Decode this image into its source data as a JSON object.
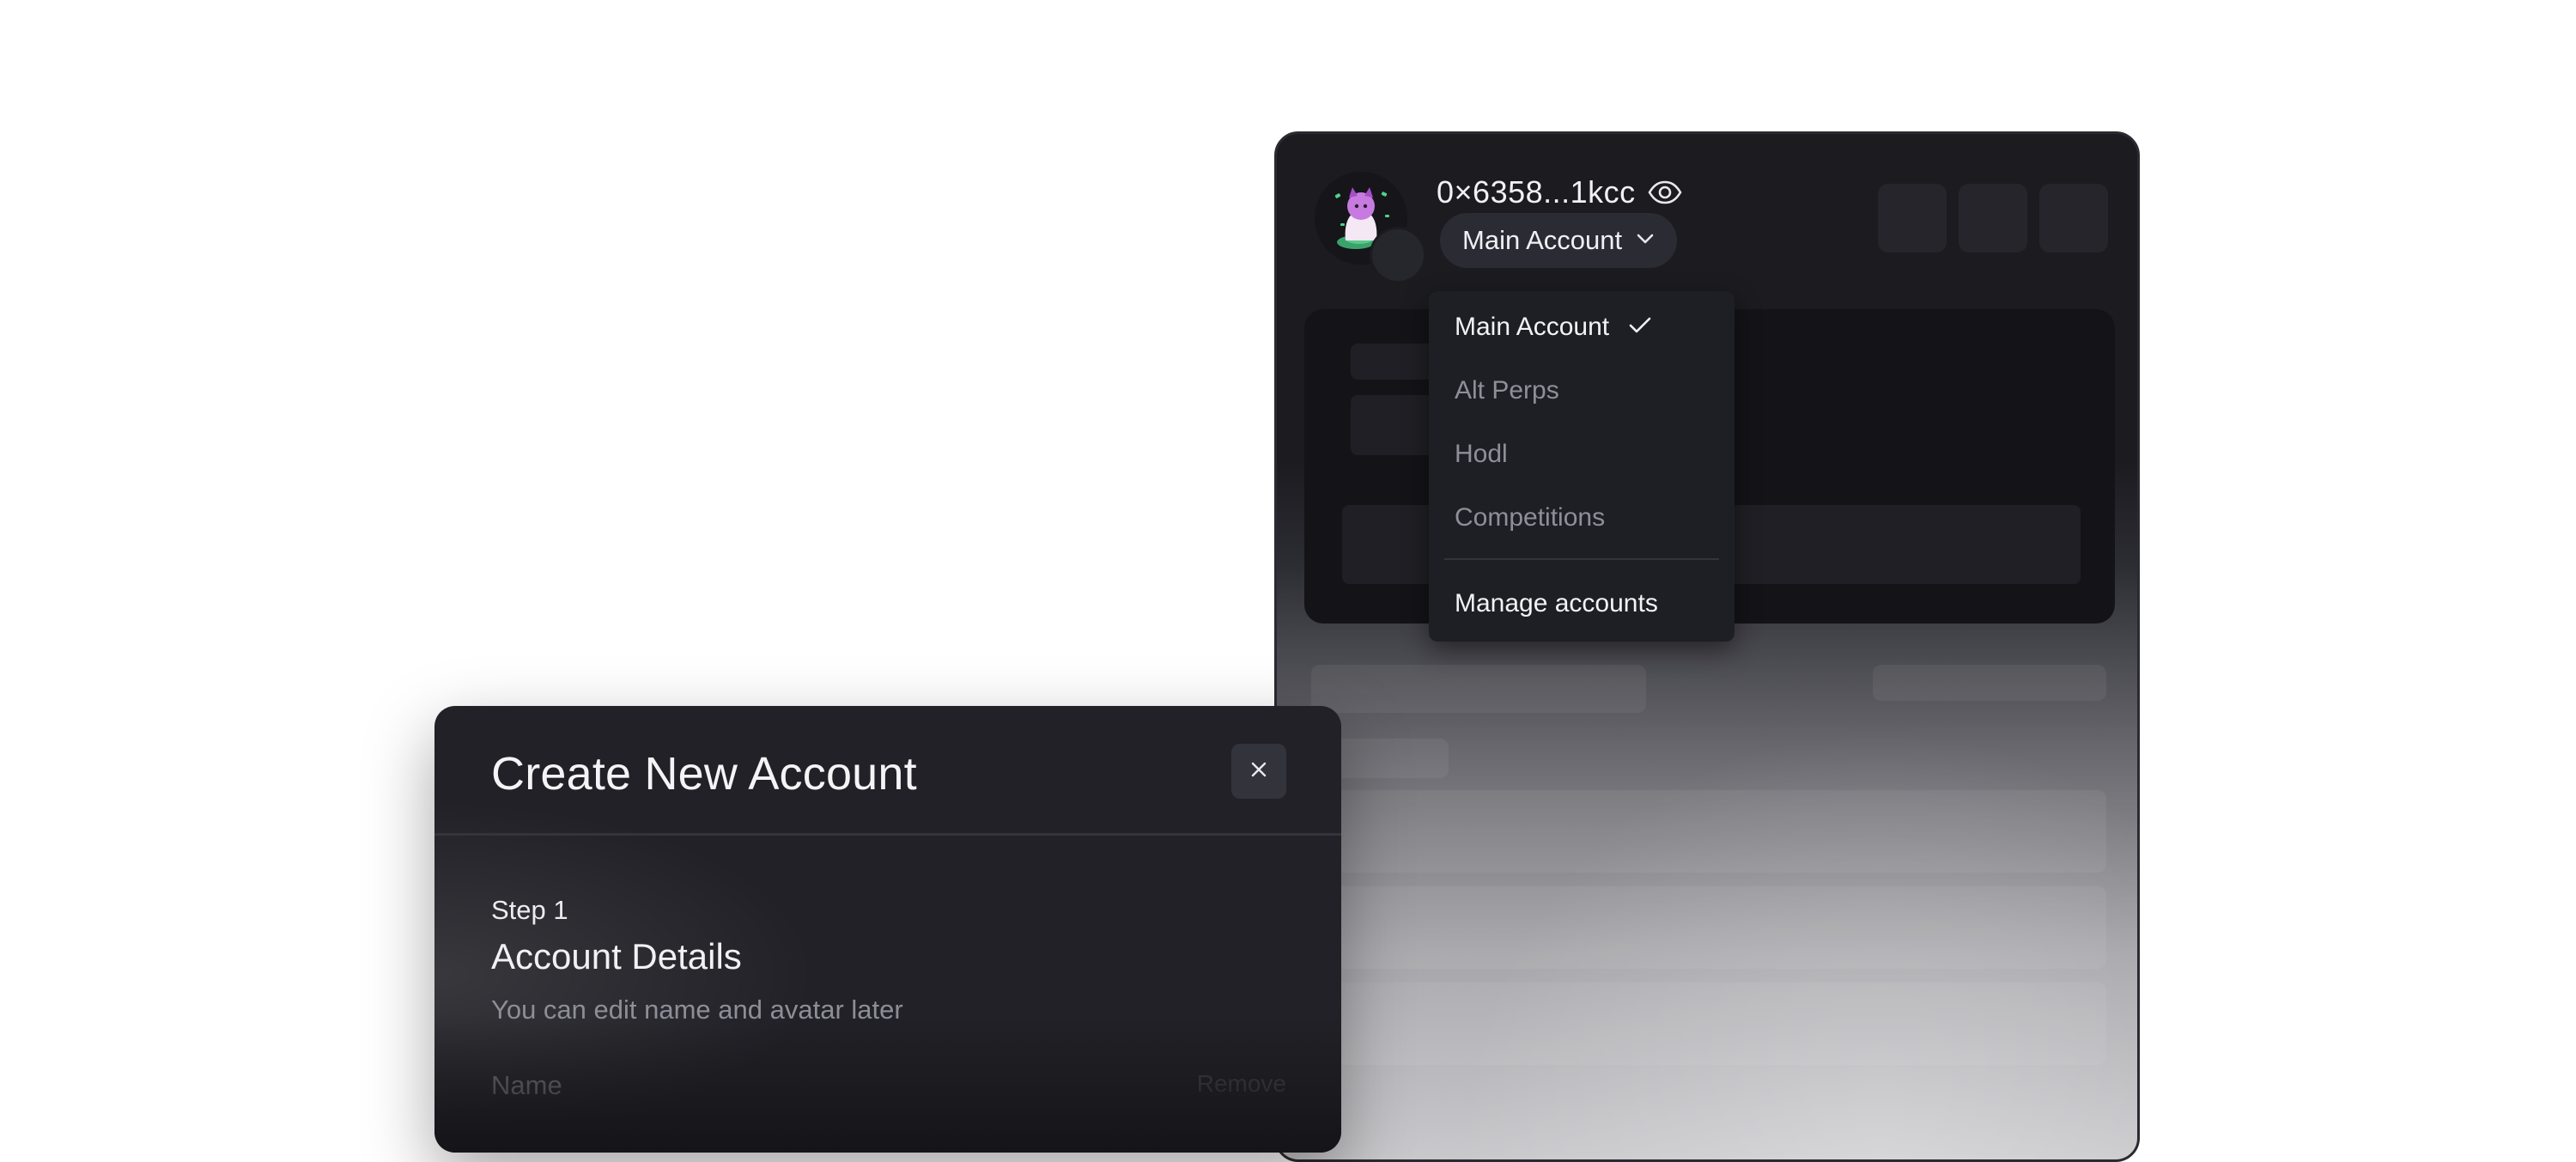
{
  "wallet": {
    "address": "0×6358...1kcc",
    "account_selector_label": "Main Account"
  },
  "dropdown": {
    "items": [
      {
        "label": "Main Account",
        "selected": true
      },
      {
        "label": "Alt Perps",
        "selected": false
      },
      {
        "label": "Hodl",
        "selected": false
      },
      {
        "label": "Competitions",
        "selected": false
      }
    ],
    "manage_label": "Manage accounts"
  },
  "modal": {
    "title": "Create New Account",
    "step": "Step 1",
    "section_title": "Account Details",
    "hint": "You can edit name and avatar later",
    "name_label": "Name",
    "remove_label": "Remove"
  },
  "icons": {
    "visibility": "eye-icon",
    "selector_caret": "chevron-down-icon",
    "selected_mark": "checkmark-icon",
    "close": "close-icon"
  },
  "colors": {
    "panel_background": "#1b1b20",
    "menu_background": "#1e1e25",
    "modal_background": "#212127",
    "muted_text": "#8f8f99"
  }
}
